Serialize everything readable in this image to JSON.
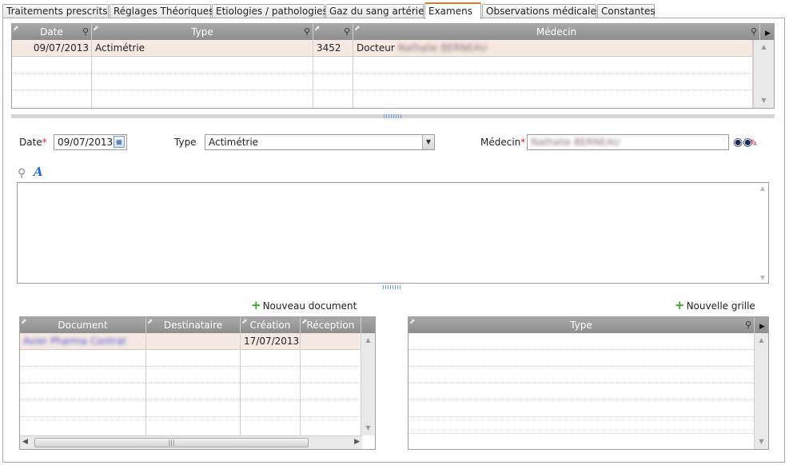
{
  "tabs": [
    {
      "label": "Traitements prescrits"
    },
    {
      "label": "Réglages Théoriques"
    },
    {
      "label": "Etiologies / pathologies"
    },
    {
      "label": "Gaz du sang artériel"
    },
    {
      "label": "Examens",
      "active": true
    },
    {
      "label": "Observations médicales"
    },
    {
      "label": "Constantes"
    }
  ],
  "exams_grid": {
    "columns": [
      "Date",
      "Type",
      "",
      "Médecin"
    ],
    "rows": [
      {
        "date": "09/07/2013",
        "type": "Actimétrie",
        "code": "3452",
        "doctor_prefix": "Docteur",
        "doctor_name": "Nathalie BERNEAU"
      }
    ]
  },
  "form": {
    "date_label": "Date",
    "date_value": "09/07/2013",
    "type_label": "Type",
    "type_value": "Actimétrie",
    "doctor_label": "Médecin",
    "doctor_value": "Nathalie BERNEAU",
    "required_mark": "*"
  },
  "documents": {
    "add_label": "Nouveau document",
    "columns": [
      "Document",
      "Destinataire",
      "Création",
      "Réception"
    ],
    "rows": [
      {
        "document": "Avier Pharma Contrat",
        "recipient": "",
        "created": "17/07/2013",
        "received": ""
      }
    ]
  },
  "grids": {
    "add_label": "Nouvelle grille",
    "columns": [
      "Type"
    ]
  },
  "icons": {
    "search": "search-icon",
    "font_style": "font-style-icon",
    "calendar": "calendar-icon",
    "binoculars": "binoculars-icon",
    "eraser": "eraser-icon",
    "add": "plus-icon"
  },
  "colors": {
    "active_tab_accent": "#e07a2a",
    "selected_row": "#f6e9e2",
    "header_bg": "#9a9a9a",
    "add_icon": "#3aa22a",
    "required": "#d82020"
  }
}
